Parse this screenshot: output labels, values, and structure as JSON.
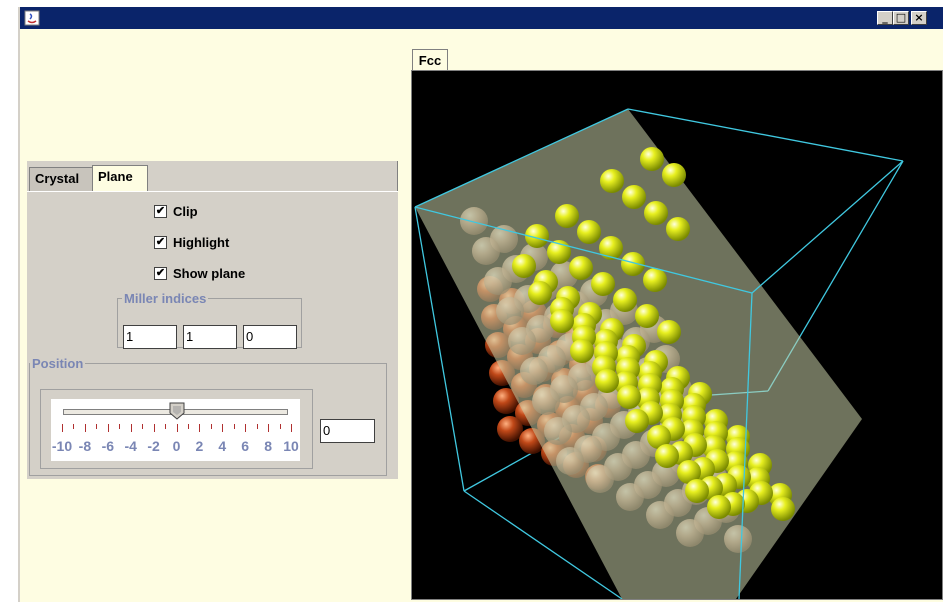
{
  "window": {
    "title": "",
    "buttons": {
      "minimize": "_",
      "maximize": "□",
      "close": "×"
    }
  },
  "control_panel": {
    "tabs": [
      {
        "label": "Crystal",
        "selected": false
      },
      {
        "label": "Plane",
        "selected": true
      }
    ],
    "checkboxes": [
      {
        "label": "Clip",
        "checked": true
      },
      {
        "label": "Highlight",
        "checked": true
      },
      {
        "label": "Show plane",
        "checked": true
      }
    ],
    "check_mark": "✔",
    "miller": {
      "legend": "Miller indices",
      "h": "1",
      "k": "1",
      "l": "0"
    },
    "position": {
      "legend": "Position",
      "slider_min": -10,
      "slider_max": 10,
      "slider_value": 0,
      "tick_labels": [
        "-10",
        "-8",
        "-6",
        "-4",
        "-2",
        "0",
        "2",
        "4",
        "6",
        "8",
        "10"
      ],
      "field_value": "0"
    }
  },
  "viewer": {
    "tab_label": "Fcc",
    "background_color": "#000000",
    "box_edge_color": "#40c8e0",
    "plane_color": "#c8d0a8",
    "highlight_atom_color": "#e8f020",
    "clipped_atom_color": "#c04818",
    "faded_atom_color": "#d8b8a0"
  }
}
